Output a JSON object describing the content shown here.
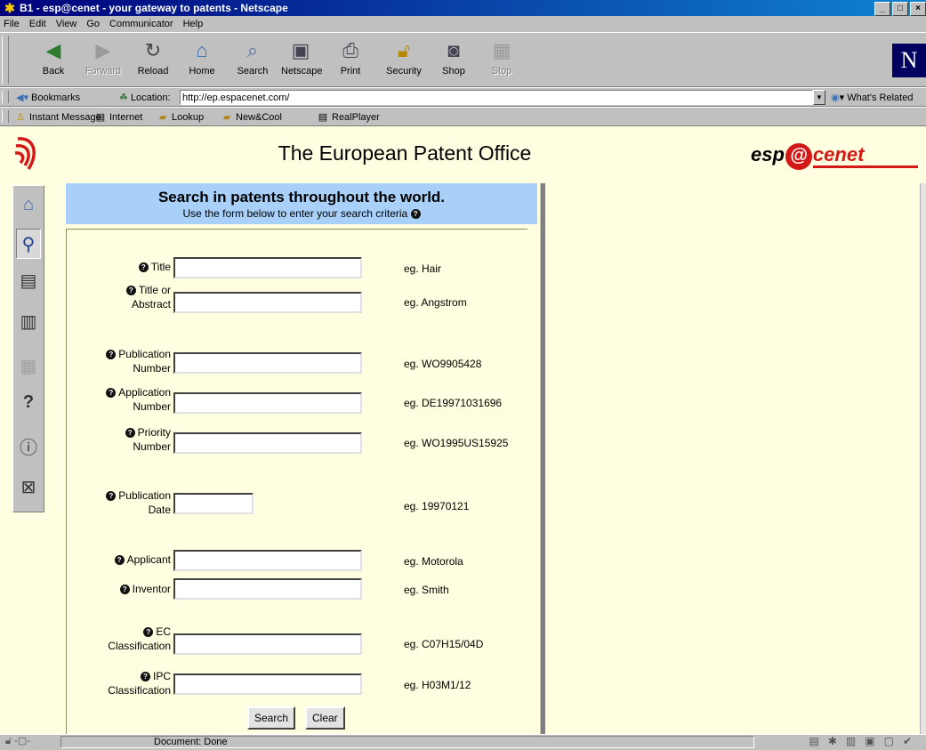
{
  "window": {
    "title": "B1 - esp@cenet -  your gateway to patents - Netscape",
    "controls": [
      "_",
      "□",
      "×"
    ]
  },
  "menu": [
    "File",
    "Edit",
    "View",
    "Go",
    "Communicator",
    "Help"
  ],
  "navigation_toolbar": [
    {
      "label": "Back",
      "icon": "back-arrow-icon",
      "enabled": true
    },
    {
      "label": "Forward",
      "icon": "forward-arrow-icon",
      "enabled": false
    },
    {
      "label": "Reload",
      "icon": "reload-icon",
      "enabled": true
    },
    {
      "label": "Home",
      "icon": "home-icon",
      "enabled": true
    },
    {
      "label": "Search",
      "icon": "search-icon",
      "enabled": true
    },
    {
      "label": "Netscape",
      "icon": "netscape-icon",
      "enabled": true
    },
    {
      "label": "Print",
      "icon": "print-icon",
      "enabled": true
    },
    {
      "label": "Security",
      "icon": "lock-icon",
      "enabled": true
    },
    {
      "label": "Shop",
      "icon": "shop-icon",
      "enabled": true
    },
    {
      "label": "Stop",
      "icon": "stop-icon",
      "enabled": false
    }
  ],
  "location_bar": {
    "bookmarks_label": "Bookmarks",
    "location_label": "Location:",
    "url": "http://ep.espacenet.com/",
    "whats_related": "What's Related"
  },
  "personal_toolbar": [
    "Instant Message",
    "Internet",
    "Lookup",
    "New&Cool",
    "RealPlayer"
  ],
  "page": {
    "header_title": "The European Patent Office",
    "brand": {
      "part1": "esp",
      "at": "@",
      "part2": "cenet"
    },
    "search_title": "Search in patents throughout the world.",
    "search_subtitle": "Use the form below to enter your search criteria",
    "fields": [
      {
        "label_lines": [
          "Title"
        ],
        "example": "eg. Hair",
        "value": ""
      },
      {
        "label_lines": [
          "Title or",
          "Abstract"
        ],
        "example": "eg. Angstrom",
        "value": ""
      },
      {
        "label_lines": [
          "Publication",
          "Number"
        ],
        "example": "eg. WO9905428",
        "value": ""
      },
      {
        "label_lines": [
          "Application",
          "Number"
        ],
        "example": "eg. DE19971031696",
        "value": ""
      },
      {
        "label_lines": [
          "Priority",
          "Number"
        ],
        "example": "eg. WO1995US15925",
        "value": ""
      },
      {
        "label_lines": [
          "Publication",
          "Date"
        ],
        "example": "eg. 19970121",
        "value": ""
      },
      {
        "label_lines": [
          "Applicant"
        ],
        "example": "eg. Motorola",
        "value": ""
      },
      {
        "label_lines": [
          "Inventor"
        ],
        "example": "eg. Smith",
        "value": ""
      },
      {
        "label_lines": [
          "EC",
          "Classification"
        ],
        "example": "eg. C07H15/04D",
        "value": ""
      },
      {
        "label_lines": [
          "IPC",
          "Classification"
        ],
        "example": "eg. H03M1/12",
        "value": ""
      }
    ],
    "search_button": "Search",
    "clear_button": "Clear",
    "side_nav": [
      "home-icon",
      "binoculars-icon",
      "document-icon",
      "document-list-icon",
      "cart-icon",
      "question-mark-icon",
      "info-icon",
      "envelope-icon"
    ]
  },
  "status_bar": {
    "text": "Document: Done"
  },
  "colors": {
    "page_background": "#fffee0",
    "search_header": "#a8d0f8",
    "brand_red": "#d31818"
  }
}
